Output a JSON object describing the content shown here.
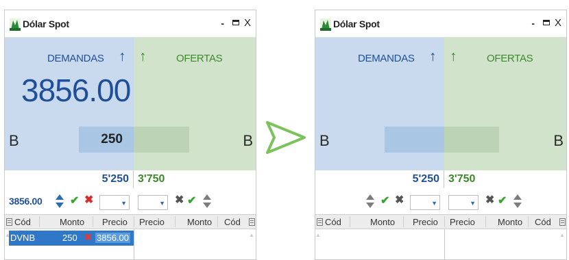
{
  "colors": {
    "demand_bg": "#c9daee",
    "offer_bg": "#d2e3cc",
    "demand_text": "#1f4f9a",
    "offer_text": "#3a8a2a",
    "selected_row": "#2f78c8",
    "transition_arrow": "#7cc35e"
  },
  "before": {
    "title": "Dólar Spot",
    "window_buttons": {
      "minimize": "-",
      "maximize": "□",
      "close": "X"
    },
    "demand_label": "DEMANDAS",
    "offer_label": "OFERTAS",
    "big_price": "3856.00",
    "side_left": "B",
    "side_right": "B",
    "qty_demand": "250",
    "total_demand": "5'250",
    "total_offer": "3'750",
    "price_input": "3856.00",
    "columns_left": [
      "Cód",
      "Monto",
      "Precio"
    ],
    "columns_right": [
      "Precio",
      "Monto",
      "Cód"
    ],
    "order": {
      "code": "DVNB",
      "amount": "250",
      "price": "3856.00"
    }
  },
  "after": {
    "title": "Dólar Spot",
    "window_buttons": {
      "minimize": "-",
      "maximize": "□",
      "close": "X"
    },
    "demand_label": "DEMANDAS",
    "offer_label": "OFERTAS",
    "side_left": "B",
    "side_right": "B",
    "total_demand": "5'250",
    "total_offer": "3'750",
    "columns_left": [
      "Cód",
      "Monto",
      "Precio"
    ],
    "columns_right": [
      "Precio",
      "Monto",
      "Cód"
    ]
  },
  "icons": {
    "up_arrow": "↑",
    "check": "✔",
    "cross": "✖",
    "dropdown": "▼",
    "scroll_up": "▲"
  }
}
